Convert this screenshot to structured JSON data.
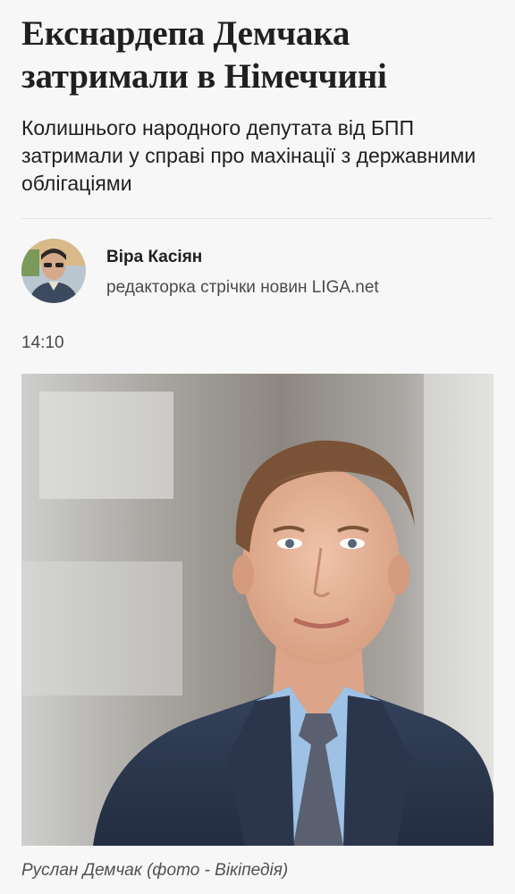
{
  "article": {
    "headline": "Екснардепа Демчака затримали в Німеччині",
    "lead": "Колишнього народного депутата від БПП затримали у справі про махінації з державними облігаціями",
    "author": {
      "name": "Віра Касіян",
      "role": "редакторка стрічки новин LIGA.net"
    },
    "time": "14:10",
    "photo_caption": "Руслан Демчак (фото - Вікіпедія)"
  }
}
